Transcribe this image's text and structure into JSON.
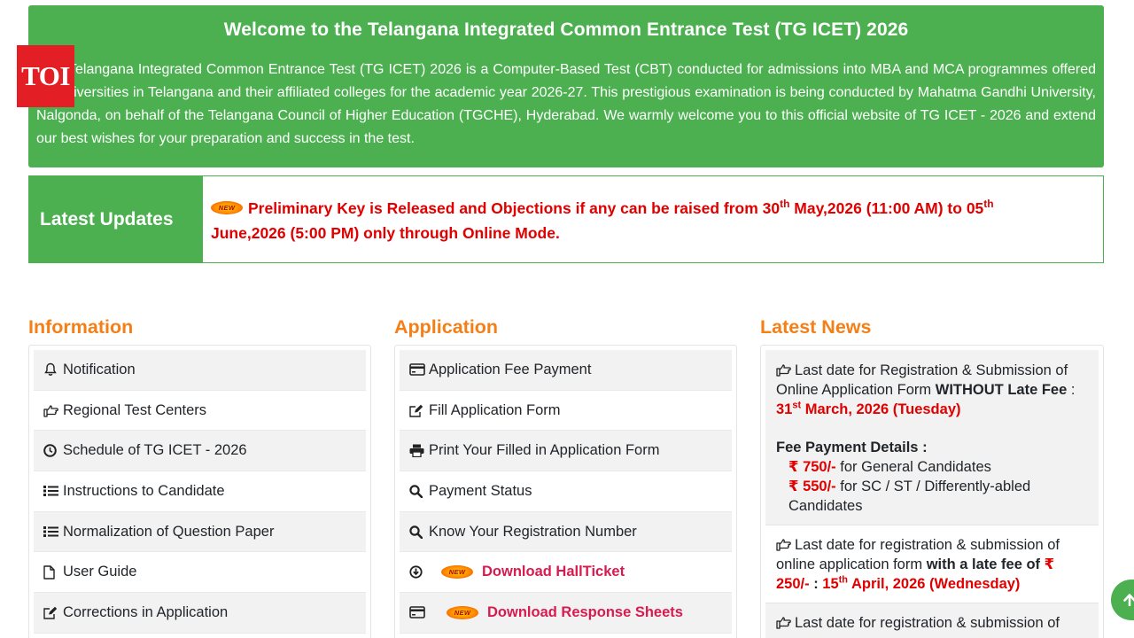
{
  "welcome": {
    "title": "Welcome to the Telangana Integrated Common Entrance Test (TG ICET) 2026",
    "text": "Telangana Integrated Common Entrance Test (TG ICET) 2026 is a Computer-Based Test (CBT) conducted for admissions into MBA and MCA programmes offered by Universities in Telangana and their affiliated colleges for the academic year 2026-27. This prestigious examination is being conducted by Mahatma Gandhi University, Nalgonda, on behalf of the Telangana Council of Higher Education (TGCHE), Hyderabad. We warmly welcome you to this official website of TG ICET - 2026 and extend our best wishes for your preparation and success in the test."
  },
  "logo": {
    "text": "TOI"
  },
  "updates": {
    "label": "Latest Updates",
    "badge": "NEW",
    "part1": "Preliminary Key is Released and Objections if any can be raised from 30",
    "sup1": "th",
    "part2": " May,2026 (11:00 AM) to 05",
    "sup2": "th",
    "part3": " June,2026 (5:00 PM) only through Online Mode."
  },
  "information": {
    "title": "Information",
    "items": [
      {
        "label": "Notification",
        "icon": "bell-icon"
      },
      {
        "label": "Regional Test Centers",
        "icon": "hand-point-right-icon"
      },
      {
        "label": "Schedule of TG ICET - 2026",
        "icon": "clock-icon"
      },
      {
        "label": "Instructions to Candidate",
        "icon": "list-icon"
      },
      {
        "label": "Normalization of Question Paper",
        "icon": "list-icon"
      },
      {
        "label": "User Guide",
        "icon": "file-icon"
      },
      {
        "label": "Corrections in Application",
        "icon": "edit-icon"
      }
    ]
  },
  "application": {
    "title": "Application",
    "items": [
      {
        "label": "Application Fee Payment",
        "icon": "credit-card-icon"
      },
      {
        "label": "Fill Application Form",
        "icon": "edit-icon"
      },
      {
        "label": "Print Your Filled in Application Form",
        "icon": "print-icon"
      },
      {
        "label": "Payment Status",
        "icon": "search-icon"
      },
      {
        "label": "Know Your Registration Number",
        "icon": "search-icon"
      },
      {
        "label": "Download HallTicket",
        "icon": "download-icon",
        "badge": "NEW"
      },
      {
        "label": "Download Response Sheets",
        "icon": "credit-card-icon",
        "badge": "NEW"
      }
    ]
  },
  "news": {
    "title": "Latest News",
    "item1": {
      "text": "Last date for Registration & Submission of Online Application Form ",
      "bold": "WITHOUT Late Fee",
      "sep": " : ",
      "date_pre": "31",
      "date_sup": "st",
      "date_post": " March, 2026 (Tuesday)",
      "fee_heading": "Fee Payment Details :",
      "fee1_amount": "₹ 750/-",
      "fee1_text": " for General Candidates",
      "fee2_amount": "₹ 550/-",
      "fee2_text": " for SC / ST / Differently-abled Candidates"
    },
    "item2": {
      "text": "Last date for registration & submission of online application form ",
      "bold": "with a late fee of",
      "amount": "₹ 250/-",
      "sep": " : ",
      "date_pre": "15",
      "date_sup": "th",
      "date_post": " April, 2026 (Wednesday)"
    },
    "item3": {
      "text": "Last date for registration & submission of"
    }
  },
  "colors": {
    "green": "#4cb050",
    "orange": "#f57f17",
    "red": "#e00000"
  }
}
